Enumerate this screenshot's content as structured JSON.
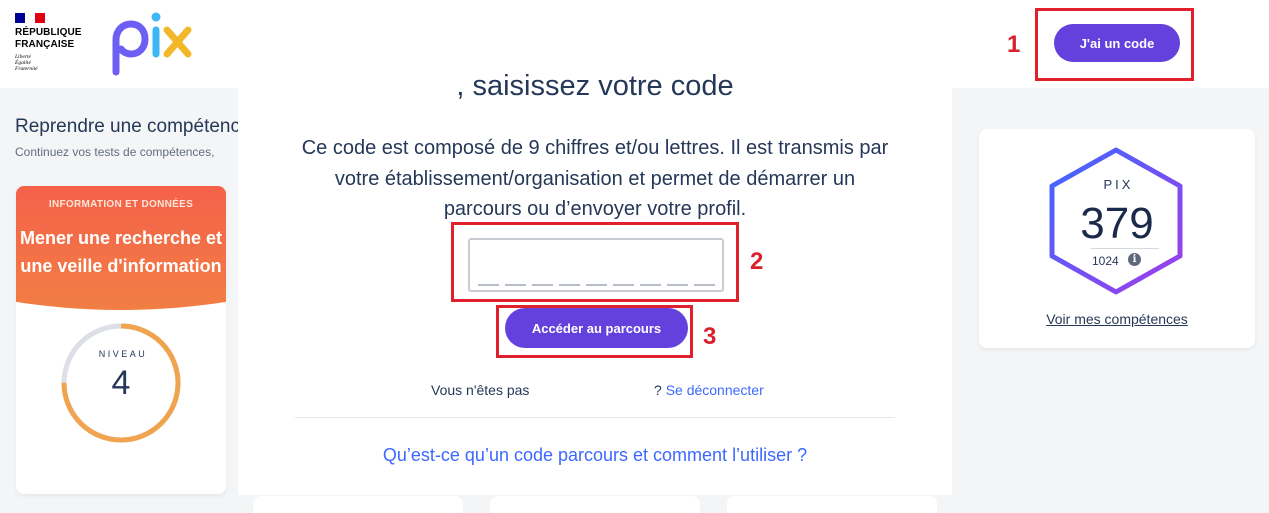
{
  "header": {
    "gov": {
      "line1": "RÉPUBLIQUE",
      "line2": "FRANÇAISE",
      "devise": [
        "Liberté",
        "Égalité",
        "Fraternité"
      ]
    },
    "logo": "pix",
    "code_button": "J'ai un code"
  },
  "annotations": [
    "1",
    "2",
    "3"
  ],
  "competences": {
    "title": "Reprendre une compétence",
    "subtitle": "Continuez vos tests de compétences,",
    "card": {
      "domain": "INFORMATION ET DONNÉES",
      "name": "Mener une recherche et une veille d'information",
      "level_label": "NIVEAU",
      "level": "4",
      "progress": 0.75
    }
  },
  "score": {
    "label": "PIX",
    "value": "379",
    "max": "1024",
    "link": "Voir mes compétences"
  },
  "modal": {
    "title": ", saisissez votre code",
    "description": "Ce code est composé de 9 chiffres et/ou lettres. Il est transmis par votre établissement/organisation et permet de démarrer un parcours ou d’envoyer votre profil.",
    "code_value": "",
    "code_length": 9,
    "submit": "Accéder au parcours",
    "not_you": "Vous n'êtes pas",
    "logout_prefix": "?",
    "logout": "Se déconnecter",
    "help": "Qu’est-ce qu’un code parcours et comment l’utiliser ?"
  },
  "colors": {
    "primary": "#6441dc",
    "link": "#3d68ff",
    "annotation": "#e0202c",
    "text": "#253858"
  }
}
